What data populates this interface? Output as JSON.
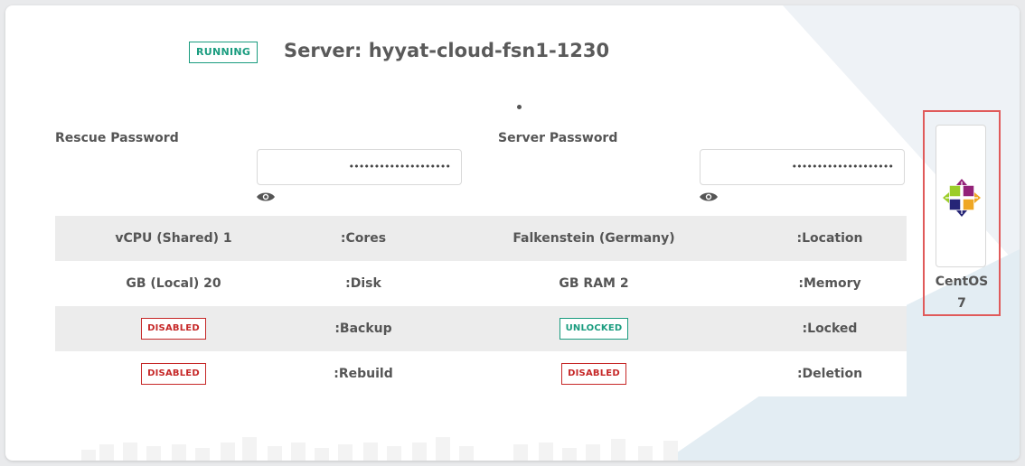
{
  "server": {
    "status": "RUNNING",
    "title": "Server: hyyat-cloud-fsn1-1230"
  },
  "passwords": {
    "rescue_label": "Rescue Password",
    "rescue_value": "••••••••••••••••••••",
    "server_label": "Server Password",
    "server_value": "••••••••••••••••••••",
    "reveal_icon": "eye-icon"
  },
  "specs": {
    "rows": [
      {
        "v1": "vCPU (Shared) 1",
        "k1": ":Cores",
        "v2": "Falkenstein (Germany)",
        "k2": ":Location"
      },
      {
        "v1": "GB (Local) 20",
        "k1": ":Disk",
        "v2": "GB RAM 2",
        "k2": ":Memory"
      },
      {
        "v1": "DISABLED",
        "k1": ":Backup",
        "v2": "UNLOCKED",
        "k2": ":Locked"
      },
      {
        "v1": "DISABLED",
        "k1": ":Rebuild",
        "v2": "DISABLED",
        "k2": ":Deletion"
      }
    ]
  },
  "os": {
    "name": "CentOS",
    "version": "7",
    "icon": "centos-logo-icon"
  },
  "colors": {
    "running": "#1a9c7f",
    "disabled": "#c62828",
    "unlocked": "#1a9c7f",
    "highlight": "#e05a5a"
  }
}
